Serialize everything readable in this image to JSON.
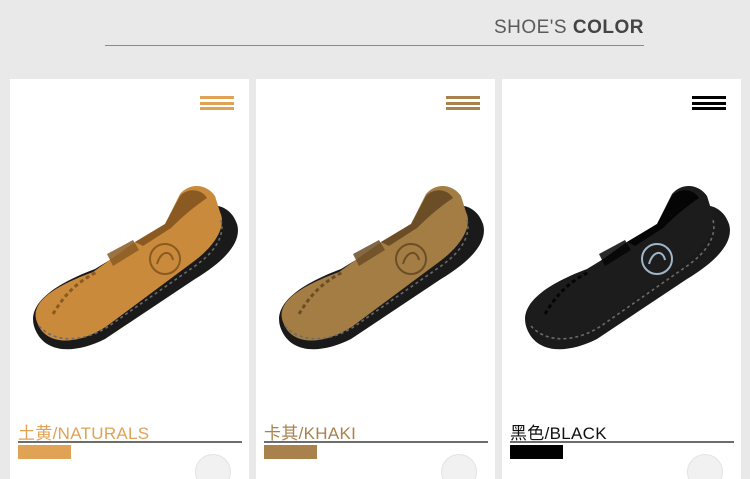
{
  "header": {
    "title_light": "SHOE'S ",
    "title_bold": "COLOR"
  },
  "cards": [
    {
      "label": "土黄/NATURALS",
      "color": "#e0a255",
      "label_color": "#e0a255",
      "shoe_color": "#c98a3c",
      "shoe_dark": "#8a5a22",
      "icon": "menu-icon"
    },
    {
      "label": "卡其/KHAKI",
      "color": "#a8814d",
      "label_color": "#a8814d",
      "shoe_color": "#a47d45",
      "shoe_dark": "#6c4e26",
      "icon": "menu-icon"
    },
    {
      "label": "黑色/BLACK",
      "color": "#000000",
      "label_color": "#111111",
      "shoe_color": "#1c1c1c",
      "shoe_dark": "#050505",
      "icon": "menu-icon"
    }
  ]
}
